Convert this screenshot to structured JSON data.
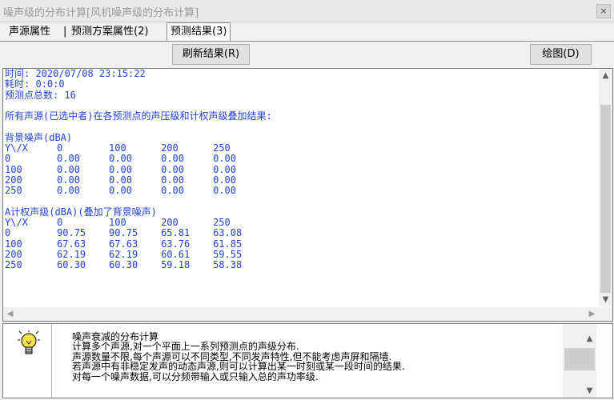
{
  "window": {
    "title": "噪声级的分布计算[风机噪声级的分布计算]",
    "close_label": "×"
  },
  "tabs": [
    {
      "label": "声源属性"
    },
    {
      "label": "预测方案属性(2)"
    },
    {
      "label": "预测结果(3)"
    }
  ],
  "tab_separator": "|",
  "toolbar": {
    "refresh_label": "刷新结果(R)",
    "draw_label": "绘图(D)"
  },
  "output": {
    "lines": [
      "时间: 2020/07/08 23:15:22",
      "耗时: 0:0:0",
      "预测点总数: 16",
      "",
      "所有声源(已选中者)在各预测点的声压级和计权声级叠加结果:",
      "",
      "背景噪声(dBA)",
      "Y\\/X     0        100      200      250",
      "0        0.00     0.00     0.00     0.00",
      "100      0.00     0.00     0.00     0.00",
      "200      0.00     0.00     0.00     0.00",
      "250      0.00     0.00     0.00     0.00",
      "",
      "A计权声级(dBA)(叠加了背景噪声)",
      "Y\\/X     0        100      200      250",
      "0        90.75    90.75    65.81    63.08",
      "100      67.63    67.63    63.76    61.85",
      "200      62.19    62.19    60.61    59.55",
      "250      60.30    60.30    59.18    58.38"
    ]
  },
  "info": {
    "heading": "噪声衰减的分布计算",
    "lines": [
      "计算多个声源,对一个平面上一系列预测点的声级分布.",
      "声源数量不限,每个声源可以不同类型,不同发声特性,但不能考虑声屏和隔墙.",
      "若声源中有非稳定发声的动态声源,则可以计算出某一时刻或某一段时间的结果.",
      "对每一个噪声数据,可以分频带输入或只输入总的声功率级."
    ]
  },
  "icons": {
    "up": "up-arrow-icon",
    "down": "down-arrow-icon",
    "left": "left-arrow-icon",
    "right": "right-arrow-icon",
    "bulb": "lightbulb-icon"
  },
  "colors": {
    "output_text": "#1f3fe0",
    "bulb": "#f7e04a"
  }
}
